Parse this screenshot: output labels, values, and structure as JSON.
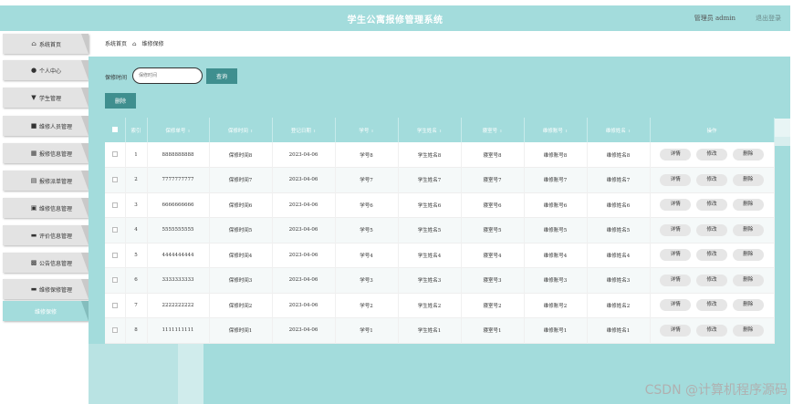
{
  "header": {
    "title": "学生公寓报修管理系统",
    "admin_label": "管理员 admin",
    "logout_label": "退出登录"
  },
  "sidebar": {
    "items": [
      {
        "label": "系统首页",
        "icon": "home-icon",
        "glyph": "⌂"
      },
      {
        "label": "个人中心",
        "icon": "user-icon",
        "glyph": "●"
      },
      {
        "label": "学生管理",
        "icon": "student-icon",
        "glyph": "▼"
      },
      {
        "label": "维修人员管理",
        "icon": "briefcase-icon",
        "glyph": "■"
      },
      {
        "label": "报修信息管理",
        "icon": "grid-icon",
        "glyph": "▦"
      },
      {
        "label": "报修派单管理",
        "icon": "clipboard-icon",
        "glyph": "▤"
      },
      {
        "label": "维修信息管理",
        "icon": "clipboard-check-icon",
        "glyph": "▣"
      },
      {
        "label": "评价信息管理",
        "icon": "monitor-icon",
        "glyph": "▬"
      },
      {
        "label": "公告信息管理",
        "icon": "apps-icon",
        "glyph": "▩"
      },
      {
        "label": "维修保修管理",
        "icon": "repair-icon",
        "glyph": "▬"
      },
      {
        "label": "维修保修",
        "icon": "",
        "glyph": ""
      }
    ]
  },
  "breadcrumb": {
    "home": "系统首页",
    "separator": "⌂",
    "current": "维修保修"
  },
  "search": {
    "label": "保修时间",
    "placeholder": "保修时间",
    "button": "查询"
  },
  "actions": {
    "delete": "删除"
  },
  "table": {
    "headers": [
      "索引",
      "保修单号",
      "保修时间",
      "登记日期",
      "学号",
      "学生姓名",
      "寝室号",
      "维修账号",
      "维修姓名",
      "操作"
    ],
    "rows": [
      [
        "1",
        "8888888888",
        "保修时间8",
        "2023-04-06",
        "学号8",
        "学生姓名8",
        "寝室号8",
        "维修账号8",
        "维修姓名8"
      ],
      [
        "2",
        "7777777777",
        "保修时间7",
        "2023-04-06",
        "学号7",
        "学生姓名7",
        "寝室号7",
        "维修账号7",
        "维修姓名7"
      ],
      [
        "3",
        "6666666666",
        "保修时间6",
        "2023-04-06",
        "学号6",
        "学生姓名6",
        "寝室号6",
        "维修账号6",
        "维修姓名6"
      ],
      [
        "4",
        "5555555555",
        "保修时间5",
        "2023-04-06",
        "学号5",
        "学生姓名5",
        "寝室号5",
        "维修账号5",
        "维修姓名5"
      ],
      [
        "5",
        "4444444444",
        "保修时间4",
        "2023-04-06",
        "学号4",
        "学生姓名4",
        "寝室号4",
        "维修账号4",
        "维修姓名4"
      ],
      [
        "6",
        "3333333333",
        "保修时间3",
        "2023-04-06",
        "学号3",
        "学生姓名3",
        "寝室号3",
        "维修账号3",
        "维修姓名3"
      ],
      [
        "7",
        "2222222222",
        "保修时间2",
        "2023-04-06",
        "学号2",
        "学生姓名2",
        "寝室号2",
        "维修账号2",
        "维修姓名2"
      ],
      [
        "8",
        "1111111111",
        "保修时间1",
        "2023-04-06",
        "学号1",
        "学生姓名1",
        "寝室号1",
        "维修账号1",
        "维修姓名1"
      ]
    ],
    "row_actions": {
      "detail": "详情",
      "edit": "修改",
      "delete": "删除"
    }
  },
  "watermark": "CSDN @计算机程序源码"
}
